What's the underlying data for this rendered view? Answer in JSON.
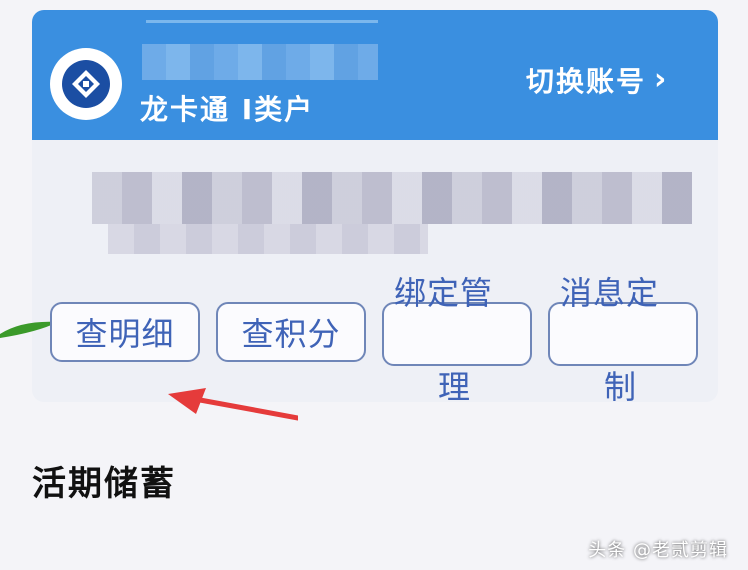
{
  "account": {
    "card_type": "龙卡通 Ⅰ类户",
    "switch_label": "切换账号",
    "switch_chevron": "›"
  },
  "actions": {
    "detail": "查明细",
    "points": "查积分",
    "bind_manage": "绑定管理",
    "message_custom": "消息定制"
  },
  "section": {
    "title": "活期储蓄"
  },
  "watermark": "头条 @老贰剪辑",
  "colors": {
    "header_blue": "#3a8fe0",
    "button_text": "#3f63b7",
    "arrow_red": "#e53b3b"
  }
}
